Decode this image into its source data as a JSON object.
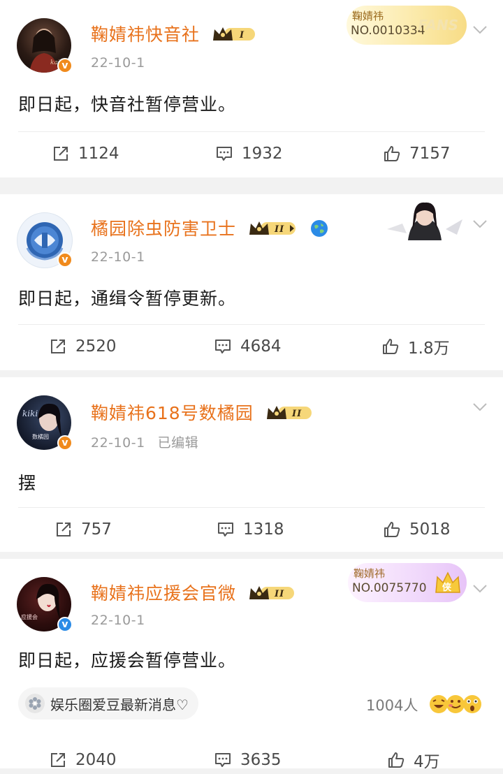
{
  "posts": [
    {
      "name": "鞠婧祎快音社",
      "vip_level": "I",
      "date": "22-10-1",
      "edited": "",
      "content": "即日起，快音社暂停营业。",
      "reposts": "1124",
      "comments": "1932",
      "likes": "7157",
      "fan_card": {
        "name": "鞠婧祎",
        "number": "NO.0010334",
        "word": "FANS"
      }
    },
    {
      "name": "橘园除虫防害卫士",
      "vip_level": "II",
      "date": "22-10-1",
      "edited": "",
      "content": "即日起，通缉令暂停更新。",
      "reposts": "2520",
      "comments": "4684",
      "likes": "1.8万"
    },
    {
      "name": "鞠婧祎618号数橘园",
      "vip_level": "II",
      "date": "22-10-1",
      "edited": "已编辑",
      "content": "摆",
      "reposts": "757",
      "comments": "1318",
      "likes": "5018"
    },
    {
      "name": "鞠婧祎应援会官微",
      "vip_level": "II",
      "date": "22-10-1",
      "edited": "",
      "content": "即日起，应援会暂停营业。",
      "reposts": "2040",
      "comments": "3635",
      "likes": "4万",
      "fan_card": {
        "name": "鞠婧祎",
        "number": "NO.0075770",
        "crown": "侠"
      },
      "topic": "娱乐圈爱豆最新消息♡",
      "participants": "1004人"
    }
  ],
  "colors": {
    "name_orange": "#e8721c",
    "badge_orange": "#f08a1c",
    "badge_blue": "#2b8be6",
    "gold": "#e9b638"
  }
}
